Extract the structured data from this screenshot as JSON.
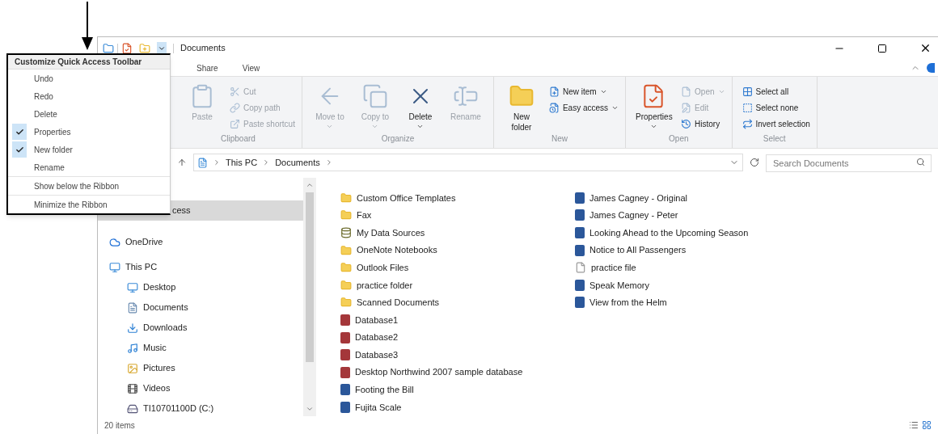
{
  "window": {
    "title": "Documents"
  },
  "tabs": [
    {
      "label": "Share",
      "selected": false
    },
    {
      "label": "View",
      "selected": false
    }
  ],
  "ribbon": {
    "groups": [
      {
        "name": "Clipboard",
        "items": [
          {
            "label": "Paste",
            "kind": "large",
            "disabled": true
          },
          {
            "label": "Cut",
            "kind": "small",
            "disabled": true
          },
          {
            "label": "Copy path",
            "kind": "small",
            "disabled": true
          },
          {
            "label": "Paste shortcut",
            "kind": "small",
            "disabled": true
          }
        ]
      },
      {
        "name": "Organize",
        "items": [
          {
            "label": "Move to",
            "kind": "large",
            "disabled": true,
            "dropdown": true
          },
          {
            "label": "Copy to",
            "kind": "large",
            "disabled": true,
            "dropdown": true
          },
          {
            "label": "Delete",
            "kind": "large",
            "disabled": false,
            "dropdown": true
          },
          {
            "label": "Rename",
            "kind": "large",
            "disabled": true
          }
        ]
      },
      {
        "name": "New",
        "items": [
          {
            "label": "New folder",
            "kind": "large",
            "disabled": false
          },
          {
            "label": "New item",
            "kind": "small",
            "disabled": false,
            "dropdown": true
          },
          {
            "label": "Easy access",
            "kind": "small",
            "disabled": false,
            "dropdown": true
          }
        ]
      },
      {
        "name": "Open",
        "items": [
          {
            "label": "Properties",
            "kind": "large",
            "disabled": false,
            "dropdown": true
          },
          {
            "label": "Open",
            "kind": "small",
            "disabled": true,
            "dropdown": true
          },
          {
            "label": "Edit",
            "kind": "small",
            "disabled": true
          },
          {
            "label": "History",
            "kind": "small",
            "disabled": false
          }
        ]
      },
      {
        "name": "Select",
        "items": [
          {
            "label": "Select all",
            "kind": "small",
            "disabled": false
          },
          {
            "label": "Select none",
            "kind": "small",
            "disabled": false
          },
          {
            "label": "Invert selection",
            "kind": "small",
            "disabled": false
          }
        ]
      }
    ]
  },
  "address": {
    "path": [
      "This PC",
      "Documents"
    ]
  },
  "search": {
    "placeholder": "Search Documents"
  },
  "nav": [
    {
      "label": "cess",
      "selected": true
    },
    {
      "label": "OneDrive",
      "selected": false
    },
    {
      "label": "This PC",
      "selected": false,
      "children": [
        {
          "label": "Desktop",
          "selected": false
        },
        {
          "label": "Documents",
          "selected": false
        },
        {
          "label": "Downloads",
          "selected": false
        },
        {
          "label": "Music",
          "selected": false
        },
        {
          "label": "Pictures",
          "selected": false
        },
        {
          "label": "Videos",
          "selected": false
        },
        {
          "label": "TI10701100D (C:)",
          "selected": false
        }
      ]
    }
  ],
  "files": [
    {
      "name": "Custom Office Templates",
      "kind": "folder"
    },
    {
      "name": "Fax",
      "kind": "folder"
    },
    {
      "name": "My Data Sources",
      "kind": "datasource"
    },
    {
      "name": "OneNote Notebooks",
      "kind": "folder"
    },
    {
      "name": "Outlook Files",
      "kind": "folder"
    },
    {
      "name": "practice folder",
      "kind": "folder"
    },
    {
      "name": "Scanned Documents",
      "kind": "folder"
    },
    {
      "name": "Database1",
      "kind": "access"
    },
    {
      "name": "Database2",
      "kind": "access"
    },
    {
      "name": "Database3",
      "kind": "access"
    },
    {
      "name": "Desktop Northwind 2007 sample database",
      "kind": "access"
    },
    {
      "name": "Footing the Bill",
      "kind": "word"
    },
    {
      "name": "Fujita Scale",
      "kind": "word"
    },
    {
      "name": "James Cagney - Original",
      "kind": "word"
    },
    {
      "name": "James Cagney - Peter",
      "kind": "word"
    },
    {
      "name": "Looking Ahead to the Upcoming Season",
      "kind": "word"
    },
    {
      "name": "Notice to All Passengers",
      "kind": "word"
    },
    {
      "name": "practice file",
      "kind": "file"
    },
    {
      "name": "Speak Memory",
      "kind": "word"
    },
    {
      "name": "View from the Helm",
      "kind": "word"
    }
  ],
  "status_bar": {
    "count": "20 items"
  },
  "menu": {
    "title": "Customize Quick Access Toolbar",
    "items": [
      {
        "label": "Undo",
        "checked": false,
        "kind": "command"
      },
      {
        "label": "Redo",
        "checked": false,
        "kind": "command"
      },
      {
        "label": "Delete",
        "checked": false,
        "kind": "command"
      },
      {
        "label": "Properties",
        "checked": true,
        "kind": "command"
      },
      {
        "label": "New folder",
        "checked": true,
        "kind": "command"
      },
      {
        "label": "Rename",
        "checked": false,
        "kind": "command"
      },
      {
        "label": "Show below the Ribbon",
        "checked": false,
        "kind": "option"
      },
      {
        "label": "Minimize the Ribbon",
        "checked": false,
        "kind": "option"
      }
    ]
  }
}
